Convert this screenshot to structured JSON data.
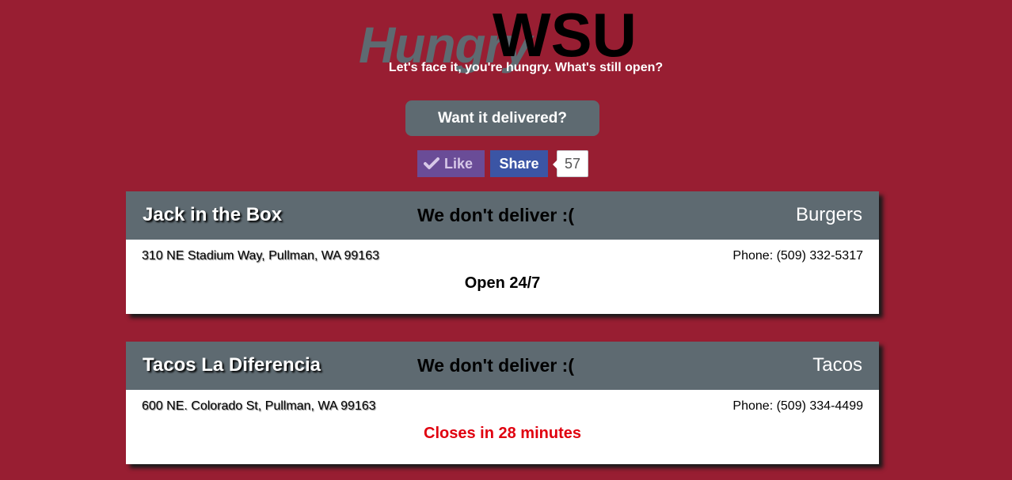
{
  "header": {
    "logo_hungry": "Hungry",
    "logo_wsu": "WSU",
    "tagline": "Let's face it, you're hungry. What's still open?"
  },
  "delivery_button": "Want it delivered?",
  "social": {
    "like_label": "Like",
    "share_label": "Share",
    "count": "57",
    "like_color": "#6a4c97",
    "share_color": "#3b55a5"
  },
  "colors": {
    "background": "#981e32",
    "card_header": "#5e6a71",
    "closing_text": "#e0000f"
  },
  "restaurants": [
    {
      "name": "Jack in the Box",
      "delivery": "We don't deliver :(",
      "category": "Burgers",
      "address": "310 NE Stadium Way, Pullman, WA 99163",
      "phone": "Phone: (509) 332-5317",
      "status": "Open 24/7"
    },
    {
      "name": "Tacos La Diferencia",
      "delivery": "We don't deliver :(",
      "category": "Tacos",
      "address": "600 NE. Colorado St, Pullman, WA 99163",
      "phone": "Phone: (509) 334-4499",
      "status": "Closes in 28 minutes"
    }
  ]
}
